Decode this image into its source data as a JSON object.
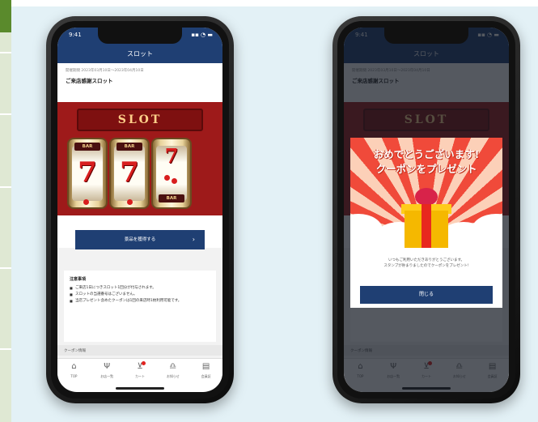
{
  "phone_left": {
    "status": {
      "time": "9:41",
      "icons": "▪▪ ◔ ▬"
    },
    "nav_title": "スロット",
    "period": "開催期間 2023年03月10日〜2023年04月10日",
    "slot_name": "ご来店感謝スロット",
    "slot_title": "SLOT",
    "reels": [
      {
        "top_label": "BAR",
        "symbol": "7"
      },
      {
        "top_label": "BAR",
        "symbol": "7"
      },
      {
        "top_label": "7",
        "bottom_label": "BAR"
      }
    ],
    "draw_button": "景品を獲得する",
    "notes_title": "注意事項",
    "notes": [
      "ご来店1日につきスロット1回分が付与されます。",
      "スロットの当選番号はございません。",
      "当店プレゼント含めたクーポンは1回の来店時1枚利用可能です。"
    ],
    "coupon_section": "クーポン情報"
  },
  "phone_right": {
    "modal_title_line1": "おめでとうございます!",
    "modal_title_line2": "クーポンをプレゼント",
    "modal_message_line1": "いつもご利用いただきありがとうございます。",
    "modal_message_line2": "スタンプが貯まりましたのでクーポンをプレゼント!",
    "close_button": "閉じる"
  },
  "tabbar": [
    {
      "label": "TOP",
      "icon": "home-icon"
    },
    {
      "label": "お店一覧",
      "icon": "fork-knife-icon"
    },
    {
      "label": "カート",
      "icon": "cart-icon"
    },
    {
      "label": "お知らせ",
      "icon": "bell-icon"
    },
    {
      "label": "会員証",
      "icon": "card-icon"
    }
  ],
  "colors": {
    "nav": "#1f3f73",
    "slot_bg": "#9e1a1a",
    "accent": "#e8281e"
  }
}
